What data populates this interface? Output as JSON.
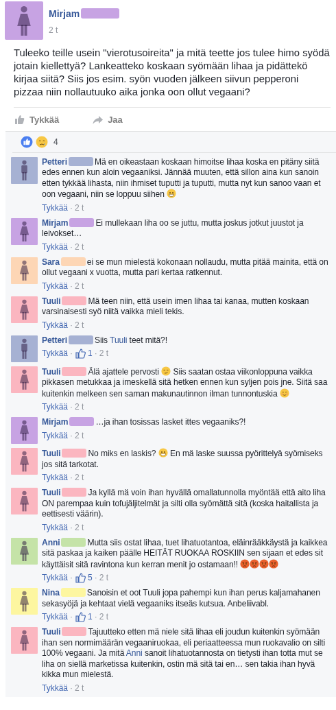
{
  "separator": "·",
  "post": {
    "author": "Mirjam",
    "color": "#c7a3e3",
    "kind": "female",
    "time": "2 t",
    "text": "Tuleeko teille usein \"vierotusoireita\" ja mitä teette jos tulee himo syödä jotain kiellettyä? Lankeatteko koskaan syömään lihaa ja pidättekö kirjaa siitä? Siis jos esim. syön vuoden jälkeen siivun pepperoni pizzaa niin nollautuuko aika jonka oon ollut vegaani?",
    "actions": [
      {
        "kind": "like",
        "label": "Tykkää"
      },
      {
        "kind": "share",
        "label": "Jaa"
      }
    ],
    "reaction_count": "4"
  },
  "comments": [
    {
      "author": "Petteri",
      "color": "#a6b1d3",
      "kind": "male",
      "like_label": "Tykkää",
      "time": "2 t",
      "parts": [
        {
          "kind": "text",
          "text": "Mä en oikeastaan koskaan himoitse lihaa koska en pitäny siitä edes ennen kun aloin vegaaniksi. Jännää muuten, että sillon aina kun sanoin etten tykkää lihasta, niin ihmiset tuputti ja tuputti, mutta nyt kun sanoo vaan et oon vegaani, niin se loppuu siihen "
        },
        {
          "kind": "grin"
        }
      ]
    },
    {
      "author": "Mirjam",
      "color": "#c7a3e3",
      "kind": "female",
      "like_label": "Tykkää",
      "time": "2 t",
      "parts": [
        {
          "kind": "text",
          "text": "Ei mullekaan liha oo se juttu, mutta joskus jotkut juustot ja leivokset…"
        }
      ]
    },
    {
      "author": "Sara",
      "color": "#fdd6b5",
      "kind": "female",
      "like_label": "Tykkää",
      "time": "2 t",
      "parts": [
        {
          "kind": "text",
          "text": "ei se mun mielestä kokonaan nollaudu, mutta pitää mainita, että on ollut vegaani x vuotta, mutta pari kertaa ratkennut."
        }
      ]
    },
    {
      "author": "Tuuli",
      "color": "#fbb6c0",
      "kind": "female",
      "like_label": "Tykkää",
      "time": "2 t",
      "parts": [
        {
          "kind": "text",
          "text": "Mä teen niin, että usein imen lihaa tai kanaa, mutten koskaan varsinaisesti syö niitä vaikka mieli tekis."
        }
      ]
    },
    {
      "author": "Petteri",
      "color": "#a6b1d3",
      "kind": "male",
      "like_label": "Tykkää",
      "time": "2 t",
      "likes": "1",
      "parts": [
        {
          "kind": "text",
          "text": "Siis "
        },
        {
          "kind": "mention",
          "text": "Tuuli"
        },
        {
          "kind": "text",
          "text": " teet mitä?!"
        }
      ]
    },
    {
      "author": "Tuuli",
      "color": "#fbb6c0",
      "kind": "female",
      "like_label": "Tykkää",
      "time": "2 t",
      "parts": [
        {
          "kind": "text",
          "text": "Älä ajattele pervosti "
        },
        {
          "kind": "smirk"
        },
        {
          "kind": "text",
          "text": " Siis saatan ostaa viikonloppuna vaikka pikkasen metukkaa ja imeskellä sitä hetken ennen kun syljen pois jne. Siitä saa kuitenkin melkeen sen saman makunautinnon ilman tunnontuskia "
        },
        {
          "kind": "blush"
        }
      ]
    },
    {
      "author": "Mirjam",
      "color": "#c7a3e3",
      "kind": "female",
      "like_label": "Tykkää",
      "time": "2 t",
      "parts": [
        {
          "kind": "text",
          "text": "…ja ihan tosissas lasket ittes vegaaniks?!"
        }
      ]
    },
    {
      "author": "Tuuli",
      "color": "#fbb6c0",
      "kind": "female",
      "like_label": "Tykkää",
      "time": "2 t",
      "parts": [
        {
          "kind": "text",
          "text": "No miks en laskis? "
        },
        {
          "kind": "grin"
        },
        {
          "kind": "text",
          "text": " En mä laske suussa pyörittelyä syömiseks jos sitä tarkotat."
        }
      ]
    },
    {
      "author": "Tuuli",
      "color": "#fbb6c0",
      "kind": "female",
      "like_label": "Tykkää",
      "time": "2 t",
      "parts": [
        {
          "kind": "text",
          "text": "Ja kyllä mä voin ihan hyvällä omallatunnolla myöntää että aito liha ON parempaa kuin tofujäljitelmät ja silti olla syömättä sitä (koska haitallista ja eettisesti väärin)."
        }
      ]
    },
    {
      "author": "Anni",
      "color": "#c5e3a8",
      "kind": "female",
      "like_label": "Tykkää",
      "time": "2 t",
      "likes": "5",
      "parts": [
        {
          "kind": "text",
          "text": "Mutta siis ostat lihaa, tuet lihatuotantoa, eläinrääkkäystä ja kaikkea sitä paskaa ja kaiken päälle HEITÄT RUOKAA ROSKIIN sen sijaan et edes sit käyttäisit sitä ravintona kun kerran menit jo ostamaan!! "
        },
        {
          "kind": "angry"
        },
        {
          "kind": "angry"
        },
        {
          "kind": "angry"
        },
        {
          "kind": "angry"
        }
      ]
    },
    {
      "author": "Nina",
      "color": "#fdf6a0",
      "kind": "female",
      "like_label": "Tykkää",
      "time": "2 t",
      "likes": "1",
      "parts": [
        {
          "kind": "text",
          "text": "Sanoisin et oot Tuuli jopa pahempi kun ihan perus kaljamahanen sekasyöjä ja kehtaat vielä vegaaniks itseäs kutsua. Anbeliivabl."
        }
      ]
    },
    {
      "author": "Tuuli",
      "color": "#fbb6c0",
      "kind": "female",
      "like_label": "Tykkää",
      "time": "2 t",
      "parts": [
        {
          "kind": "text",
          "text": "Tajuutteko etten mä niele sitä lihaa eli joudun kuitenkin syömään ihan sen normimäärän vegaaniruokaa, eli periaatteessa mun ruokavalio on silti 100% vegaani. Ja mitä "
        },
        {
          "kind": "mention",
          "text": "Anni"
        },
        {
          "kind": "text",
          "text": " sanoit lihatuotannosta on tietysti ihan totta mut se liha on siellä marketissa kuitenkin, ostin mä sitä tai en… sen takia ihan hyvä kikka mun mielestä."
        }
      ]
    }
  ]
}
